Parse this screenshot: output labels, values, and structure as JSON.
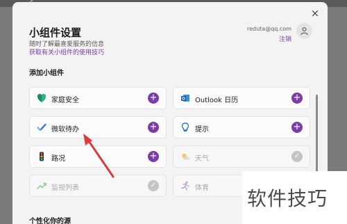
{
  "background": {
    "snippet": "↗  ..."
  },
  "dialog": {
    "close_icon": "×",
    "title": "小组件设置",
    "subtitle": "随时了解最喜爱服务的信息",
    "tips_link": "获取有关小组件的使用技巧",
    "account": {
      "email": "reduta@qq.com",
      "logout": "注销"
    },
    "section_add": "添加小组件",
    "section_personalize": "个性化你的源"
  },
  "widgets": [
    {
      "label": "家庭安全",
      "icon": "family-safety-icon",
      "state": "add"
    },
    {
      "label": "Outlook 日历",
      "icon": "outlook-calendar-icon",
      "state": "add"
    },
    {
      "label": "微软待办",
      "icon": "microsoft-todo-icon",
      "state": "add"
    },
    {
      "label": "提示",
      "icon": "tips-icon",
      "state": "add"
    },
    {
      "label": "路况",
      "icon": "traffic-icon",
      "state": "add"
    },
    {
      "label": "天气",
      "icon": "weather-icon",
      "state": "added"
    },
    {
      "label": "监视列表",
      "icon": "watchlist-icon",
      "state": "added"
    },
    {
      "label": "体育",
      "icon": "sports-icon",
      "state": "added"
    }
  ],
  "button_glyphs": {
    "add": "+",
    "added": "✓"
  },
  "watermark": "软件技巧",
  "colors": {
    "accent": "#7a3da6",
    "added_disabled": "#c4c4c4",
    "arrow": "#d93b3b"
  }
}
